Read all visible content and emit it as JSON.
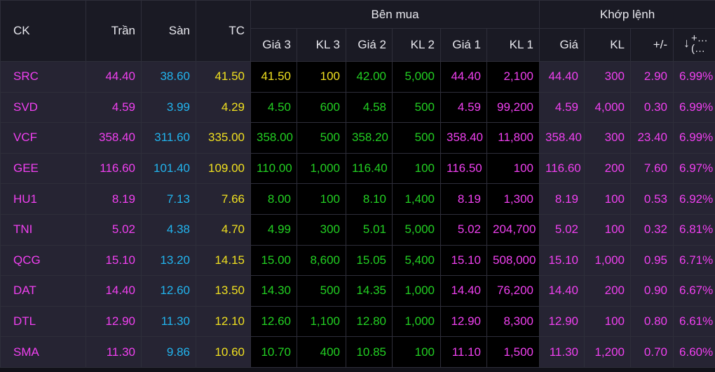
{
  "headers": {
    "symbol": "CK",
    "ceiling": "Trần",
    "floor": "Sàn",
    "reference": "TC",
    "buy_group": "Bên mua",
    "match_group": "Khớp lệnh",
    "bid_price_3": "Giá 3",
    "bid_vol_3": "KL 3",
    "bid_price_2": "Giá 2",
    "bid_vol_2": "KL 2",
    "bid_price_1": "Giá 1",
    "bid_vol_1": "KL 1",
    "match_price": "Giá",
    "match_vol": "KL",
    "change": "+/-",
    "pct_change_arrow": "↓",
    "pct_change_label": "+...\n(..."
  },
  "colors": {
    "ceiling": "#f040f0",
    "floor": "#22b4ee",
    "reference": "#f0e020",
    "up": "#22d022",
    "light_cell": "#262433",
    "dark_cell": "#000000"
  },
  "rows": [
    {
      "symbol": "SRC",
      "ceiling": "44.40",
      "floor": "38.60",
      "reference": "41.50",
      "bid_price_3": "41.50",
      "bid_vol_3": "100",
      "bid_price_2": "42.00",
      "bid_vol_2": "5,000",
      "bid_price_1": "44.40",
      "bid_vol_1": "2,100",
      "match_price": "44.40",
      "match_vol": "300",
      "change": "2.90",
      "pct_change": "6.99%"
    },
    {
      "symbol": "SVD",
      "ceiling": "4.59",
      "floor": "3.99",
      "reference": "4.29",
      "bid_price_3": "4.50",
      "bid_vol_3": "600",
      "bid_price_2": "4.58",
      "bid_vol_2": "500",
      "bid_price_1": "4.59",
      "bid_vol_1": "99,200",
      "match_price": "4.59",
      "match_vol": "4,000",
      "change": "0.30",
      "pct_change": "6.99%"
    },
    {
      "symbol": "VCF",
      "ceiling": "358.40",
      "floor": "311.60",
      "reference": "335.00",
      "bid_price_3": "358.00",
      "bid_vol_3": "500",
      "bid_price_2": "358.20",
      "bid_vol_2": "500",
      "bid_price_1": "358.40",
      "bid_vol_1": "11,800",
      "match_price": "358.40",
      "match_vol": "300",
      "change": "23.40",
      "pct_change": "6.99%"
    },
    {
      "symbol": "GEE",
      "ceiling": "116.60",
      "floor": "101.40",
      "reference": "109.00",
      "bid_price_3": "110.00",
      "bid_vol_3": "1,000",
      "bid_price_2": "116.40",
      "bid_vol_2": "100",
      "bid_price_1": "116.50",
      "bid_vol_1": "100",
      "match_price": "116.60",
      "match_vol": "200",
      "change": "7.60",
      "pct_change": "6.97%"
    },
    {
      "symbol": "HU1",
      "ceiling": "8.19",
      "floor": "7.13",
      "reference": "7.66",
      "bid_price_3": "8.00",
      "bid_vol_3": "100",
      "bid_price_2": "8.10",
      "bid_vol_2": "1,400",
      "bid_price_1": "8.19",
      "bid_vol_1": "1,300",
      "match_price": "8.19",
      "match_vol": "100",
      "change": "0.53",
      "pct_change": "6.92%"
    },
    {
      "symbol": "TNI",
      "ceiling": "5.02",
      "floor": "4.38",
      "reference": "4.70",
      "bid_price_3": "4.99",
      "bid_vol_3": "300",
      "bid_price_2": "5.01",
      "bid_vol_2": "5,000",
      "bid_price_1": "5.02",
      "bid_vol_1": "204,700",
      "match_price": "5.02",
      "match_vol": "100",
      "change": "0.32",
      "pct_change": "6.81%"
    },
    {
      "symbol": "QCG",
      "ceiling": "15.10",
      "floor": "13.20",
      "reference": "14.15",
      "bid_price_3": "15.00",
      "bid_vol_3": "8,600",
      "bid_price_2": "15.05",
      "bid_vol_2": "5,400",
      "bid_price_1": "15.10",
      "bid_vol_1": "508,000",
      "match_price": "15.10",
      "match_vol": "1,000",
      "change": "0.95",
      "pct_change": "6.71%"
    },
    {
      "symbol": "DAT",
      "ceiling": "14.40",
      "floor": "12.60",
      "reference": "13.50",
      "bid_price_3": "14.30",
      "bid_vol_3": "500",
      "bid_price_2": "14.35",
      "bid_vol_2": "1,000",
      "bid_price_1": "14.40",
      "bid_vol_1": "76,200",
      "match_price": "14.40",
      "match_vol": "200",
      "change": "0.90",
      "pct_change": "6.67%"
    },
    {
      "symbol": "DTL",
      "ceiling": "12.90",
      "floor": "11.30",
      "reference": "12.10",
      "bid_price_3": "12.60",
      "bid_vol_3": "1,100",
      "bid_price_2": "12.80",
      "bid_vol_2": "1,000",
      "bid_price_1": "12.90",
      "bid_vol_1": "8,300",
      "match_price": "12.90",
      "match_vol": "100",
      "change": "0.80",
      "pct_change": "6.61%"
    },
    {
      "symbol": "SMA",
      "ceiling": "11.30",
      "floor": "9.86",
      "reference": "10.60",
      "bid_price_3": "10.70",
      "bid_vol_3": "400",
      "bid_price_2": "10.85",
      "bid_vol_2": "100",
      "bid_price_1": "11.10",
      "bid_vol_1": "1,500",
      "match_price": "11.30",
      "match_vol": "1,200",
      "change": "0.70",
      "pct_change": "6.60%"
    }
  ]
}
